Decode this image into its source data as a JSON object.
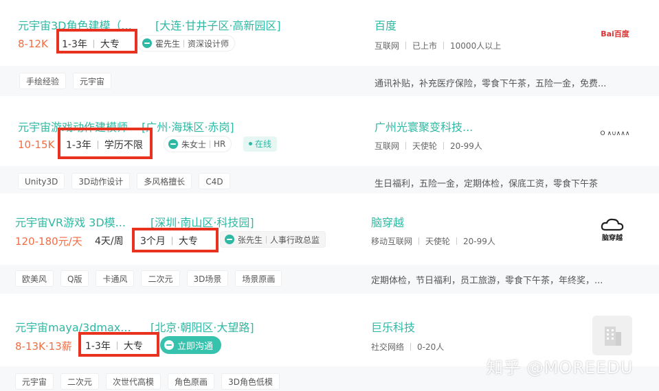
{
  "jobs": [
    {
      "title": "元宇宙3D角色建模（...",
      "location": "[大连·甘井子区·高新园区]",
      "salary": "8-12K",
      "experience": "1-3年",
      "education": "大专",
      "recruiter_name": "霍先生",
      "recruiter_title": "资深设计师",
      "company": "百度",
      "industry": "互联网",
      "stage": "已上市",
      "size": "10000人以上",
      "logo_text": "Bai百度",
      "tags": [
        "手绘经验",
        "元宇宙"
      ],
      "welfare": "通讯补贴，补充医疗保险，零食下午茶，五险一金，免费..."
    },
    {
      "title": "元宇宙游戏动作建模师",
      "location": "[广州·海珠区·赤岗]",
      "salary": "10-15K",
      "experience": "1-3年",
      "education": "学历不限",
      "recruiter_name": "朱女士",
      "recruiter_title": "HR",
      "online": "在线",
      "company": "广州光寰聚变科技...",
      "industry": "互联网",
      "stage": "天使轮",
      "size": "20-99人",
      "logo_text": "O ∧∪∧∧∧",
      "tags": [
        "Unity3D",
        "3D动作设计",
        "多风格擅长",
        "C4D"
      ],
      "welfare": "生日福利，五险一金，定期体检，保底工资，零食下午茶"
    },
    {
      "title": "元宇宙VR游戏 3D模...",
      "location": "[深圳·南山区·科技园]",
      "salary": "120-180元/天",
      "days": "4天/周",
      "experience": "3个月",
      "education": "大专",
      "recruiter_name": "张先生",
      "recruiter_title": "人事行政总监",
      "company": "脑穿越",
      "industry": "移动互联网",
      "stage": "天使轮",
      "size": "20-99人",
      "logo_text": "脑穿越",
      "tags": [
        "欧美风",
        "Q版",
        "卡通风",
        "二次元",
        "3D场景",
        "场景原画"
      ],
      "welfare": "定期体检，节日福利，员工旅游，零食下午茶，年终奖，..."
    },
    {
      "title": "元宇宙maya/3dmax...",
      "location": "[北京·朝阳区·大望路]",
      "salary": "8-13K·13薪",
      "experience": "1-3年",
      "education": "大专",
      "chat_button": "立即沟通",
      "company": "巨乐科技",
      "industry": "社交网络",
      "size": "0-20人",
      "tags": [
        "元宇宙",
        "二次元",
        "次世代高模",
        "角色原画",
        "3D角色低模"
      ]
    }
  ],
  "watermark": "知乎 @MOREEDU",
  "colors": {
    "accent": "#2fb8a3",
    "salary": "#f26d43",
    "highlight_box": "#e8321f"
  }
}
